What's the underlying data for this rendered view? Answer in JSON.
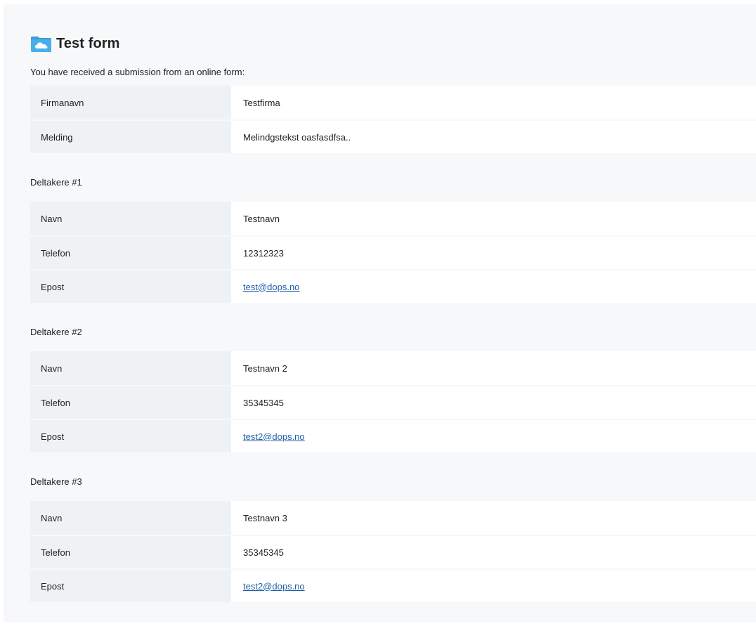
{
  "form": {
    "title": "Test form",
    "icon": "folder-cloud-icon",
    "intro": "You have received a submission from an online form:",
    "fields": [
      {
        "label": "Firmanavn",
        "value": "Testfirma"
      },
      {
        "label": "Melding",
        "value": "Melindgstekst oasfasdfsa.."
      }
    ]
  },
  "groups": [
    {
      "title": "Deltakere #1",
      "fields": [
        {
          "label": "Navn",
          "value": "Testnavn"
        },
        {
          "label": "Telefon",
          "value": "12312323"
        },
        {
          "label": "Epost",
          "value": "test@dops.no"
        }
      ]
    },
    {
      "title": "Deltakere #2",
      "fields": [
        {
          "label": "Navn",
          "value": "Testnavn 2"
        },
        {
          "label": "Telefon",
          "value": "35345345"
        },
        {
          "label": "Epost",
          "value": "test2@dops.no"
        }
      ]
    },
    {
      "title": "Deltakere #3",
      "fields": [
        {
          "label": "Navn",
          "value": "Testnavn 3"
        },
        {
          "label": "Telefon",
          "value": "35345345"
        },
        {
          "label": "Epost",
          "value": "test2@dops.no"
        }
      ]
    }
  ],
  "colors": {
    "icon_blue": "#3a9ad9",
    "link": "#1f5fa8",
    "label_bg": "#eef2f5",
    "panel_bg": "#f6f8fa"
  }
}
